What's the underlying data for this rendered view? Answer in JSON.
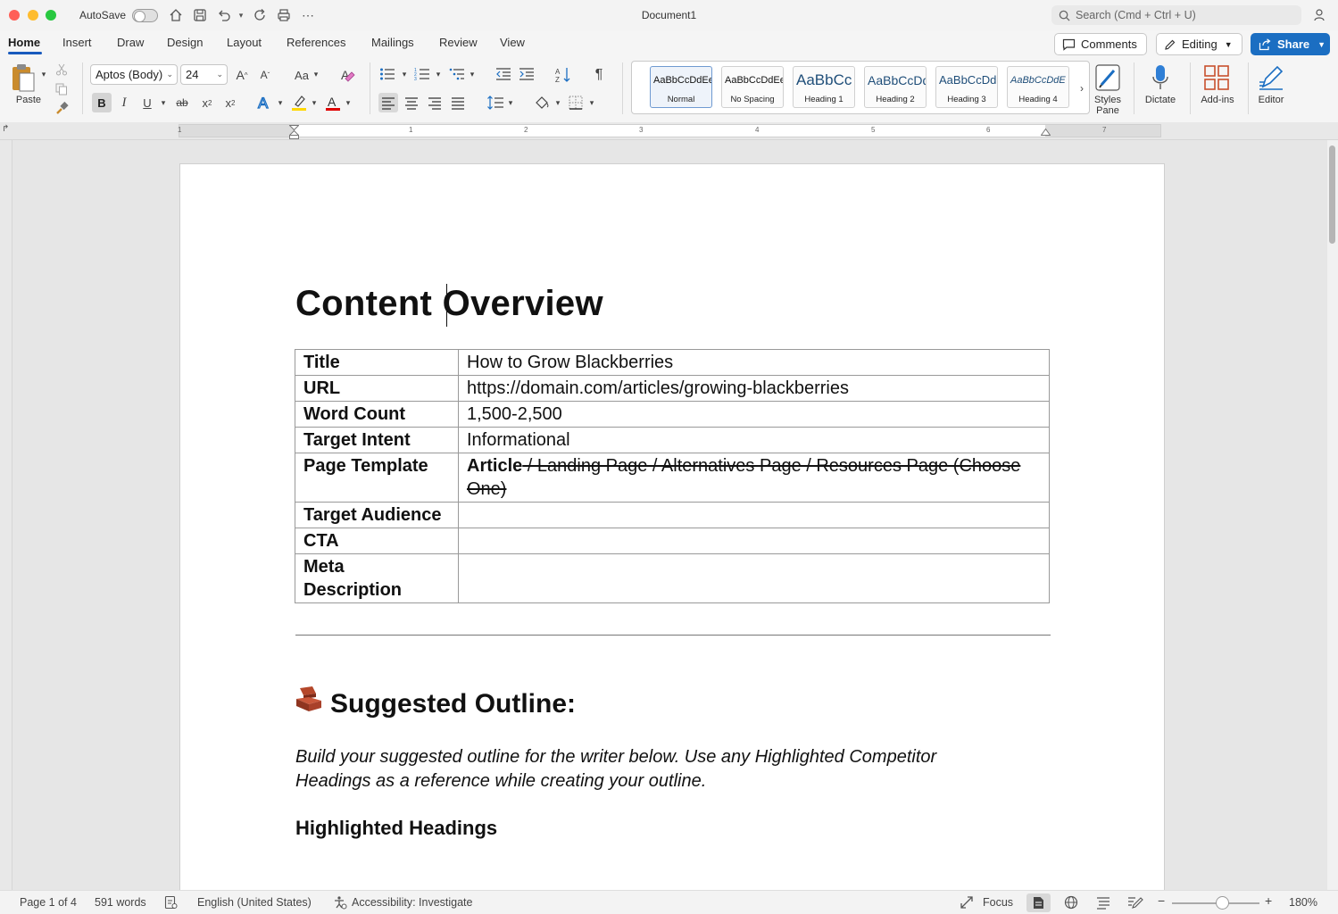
{
  "window": {
    "autosave_label": "AutoSave",
    "title": "Document1",
    "search_placeholder": "Search (Cmd + Ctrl + U)"
  },
  "tabs": [
    "Home",
    "Insert",
    "Draw",
    "Design",
    "Layout",
    "References",
    "Mailings",
    "Review",
    "View"
  ],
  "header_buttons": {
    "comments": "Comments",
    "editing": "Editing",
    "share": "Share"
  },
  "ribbon": {
    "paste_label": "Paste",
    "font_name": "Aptos (Body)",
    "font_size": "24",
    "change_case": "Aa",
    "styles": [
      {
        "preview": "AaBbCcDdEe",
        "name": "Normal"
      },
      {
        "preview": "AaBbCcDdEe",
        "name": "No Spacing"
      },
      {
        "preview": "AaBbCc",
        "name": "Heading 1"
      },
      {
        "preview": "AaBbCcDd",
        "name": "Heading 2"
      },
      {
        "preview": "AaBbCcDd",
        "name": "Heading 3"
      },
      {
        "preview": "AaBbCcDdE",
        "name": "Heading 4"
      }
    ],
    "styles_pane_label": "Styles Pane",
    "dictate_label": "Dictate",
    "addins_label": "Add-ins",
    "editor_label": "Editor",
    "highlight_color": "#ffd800",
    "font_color": "#e00000"
  },
  "ruler_numbers": [
    "1",
    "1",
    "2",
    "3",
    "4",
    "5",
    "6",
    "7"
  ],
  "document": {
    "heading_left": "Content ",
    "heading_right": "Overview",
    "table": {
      "title_key": "Title",
      "title_val": "How to Grow Blackberries",
      "url_key": "URL",
      "url_val": "https://domain.com/articles/growing-blackberries",
      "wordcount_key": "Word Count",
      "wordcount_val": "1,500-2,500",
      "intent_key": "Target Intent",
      "intent_val": "Informational",
      "template_key": "Page Template",
      "template_bold": "Article",
      "template_struck": " / Landing Page / Alternatives Page / Resources Page (Choose One)",
      "audience_key": "Target Audience",
      "audience_val": "",
      "cta_key": "CTA",
      "cta_val": "",
      "meta_key": "Meta Description",
      "meta_val": ""
    },
    "outline_heading": "Suggested Outline:",
    "outline_instructions": "Build your suggested outline for the writer below. Use any Highlighted Competitor Headings as a reference while creating your outline.",
    "highlighted_heading": "Highlighted Headings"
  },
  "status_bar": {
    "page": "Page 1 of 4",
    "words": "591 words",
    "language": "English (United States)",
    "accessibility": "Accessibility: Investigate",
    "focus": "Focus",
    "zoom": "180%"
  }
}
